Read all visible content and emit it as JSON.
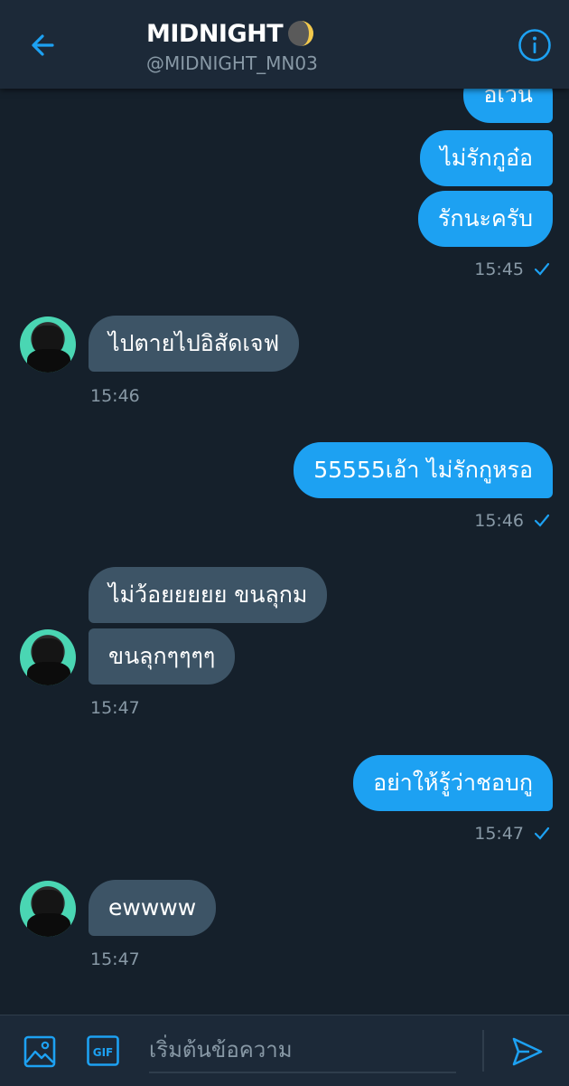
{
  "header": {
    "title": "MIDNIGHT",
    "handle": "@MIDNIGHT_MN03"
  },
  "messages": {
    "m1": "อีเวน",
    "m2": "ไม่รักกูอ๋อ",
    "m3": "รักนะครับ",
    "t1": "15:45",
    "m4": "ไปตายไปอิสัดเจฟ",
    "t2": "15:46",
    "m5": "55555เอ้า ไม่รักกูหรอ",
    "t3": "15:46",
    "m6": "ไม่ว้อยยยยย ขนลุกม",
    "m7": "ขนลุกๆๆๆๆ",
    "t4": "15:47",
    "m8": "อย่าให้รู้ว่าชอบกู",
    "t5": "15:47",
    "m9": "ewwww",
    "t6": "15:47"
  },
  "composer": {
    "placeholder": "เริ่มต้นข้อความ",
    "gif_label": "GIF"
  },
  "colors": {
    "background": "#15202b",
    "header": "#1c2938",
    "accent": "#1da1f2",
    "incoming_bubble": "#3d5466",
    "muted_text": "#8899a6"
  }
}
